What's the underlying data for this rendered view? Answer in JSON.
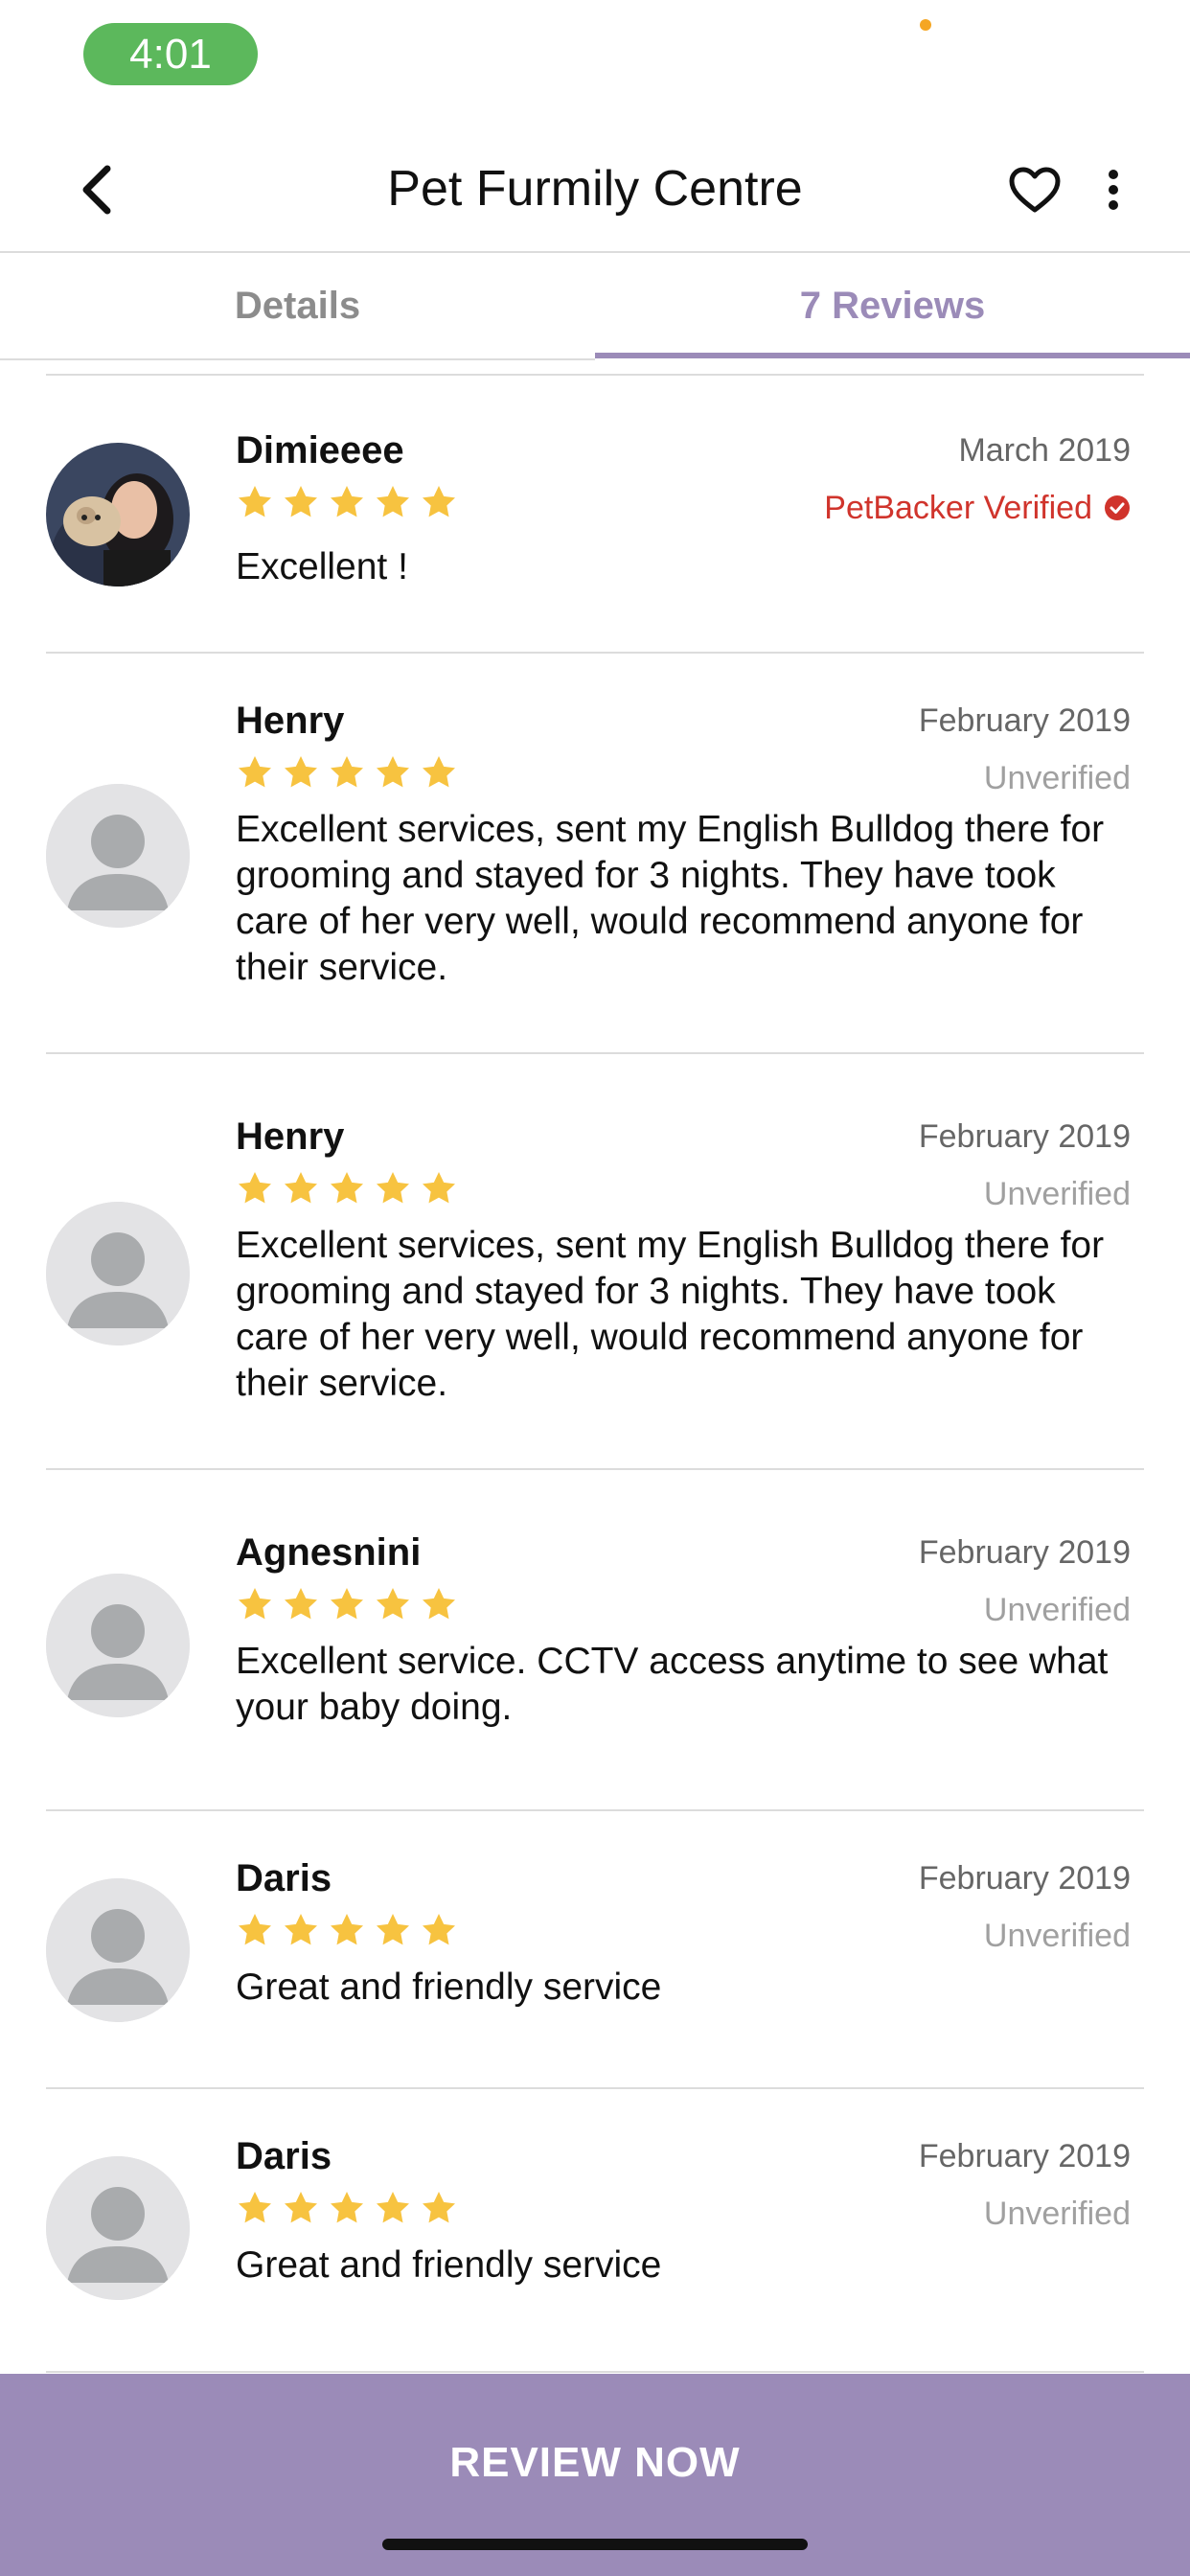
{
  "status_bar": {
    "time": "4:01"
  },
  "header": {
    "title": "Pet Furmily Centre"
  },
  "tabs": [
    {
      "label": "Details",
      "active": false
    },
    {
      "label": "7 Reviews",
      "active": true
    }
  ],
  "colors": {
    "accent": "#9b8bb8",
    "star": "#f7c340",
    "verified": "#d0342c",
    "unverified": "#a0a0a0",
    "time_pill": "#5cb85c"
  },
  "reviews": [
    {
      "name": "Dimieeee",
      "date": "March 2019",
      "status": "PetBacker Verified",
      "verified": true,
      "rating": 5,
      "text": "Excellent !",
      "avatar": "photo"
    },
    {
      "name": "Henry",
      "date": "February 2019",
      "status": "Unverified",
      "verified": false,
      "rating": 5,
      "text": "Excellent services, sent my English Bulldog there for grooming and stayed for 3 nights. They have took care of her very well, would recommend anyone for their service.",
      "avatar": "placeholder"
    },
    {
      "name": "Henry",
      "date": "February 2019",
      "status": "Unverified",
      "verified": false,
      "rating": 5,
      "text": "Excellent services, sent my English Bulldog there for grooming and stayed for 3 nights. They have took care of her very well, would recommend anyone for their service.",
      "avatar": "placeholder"
    },
    {
      "name": "Agnesnini",
      "date": "February 2019",
      "status": "Unverified",
      "verified": false,
      "rating": 5,
      "text": "Excellent service. CCTV access anytime to see what your baby doing.",
      "avatar": "placeholder"
    },
    {
      "name": "Daris",
      "date": "February 2019",
      "status": "Unverified",
      "verified": false,
      "rating": 5,
      "text": "Great and friendly service",
      "avatar": "placeholder"
    },
    {
      "name": "Daris",
      "date": "February 2019",
      "status": "Unverified",
      "verified": false,
      "rating": 5,
      "text": "Great and friendly service",
      "avatar": "placeholder"
    }
  ],
  "footer": {
    "button_label": "REVIEW NOW"
  },
  "icons": [
    "back-icon",
    "heart-icon",
    "more-vertical-icon",
    "star-icon",
    "verified-check-icon",
    "user-placeholder-icon"
  ]
}
